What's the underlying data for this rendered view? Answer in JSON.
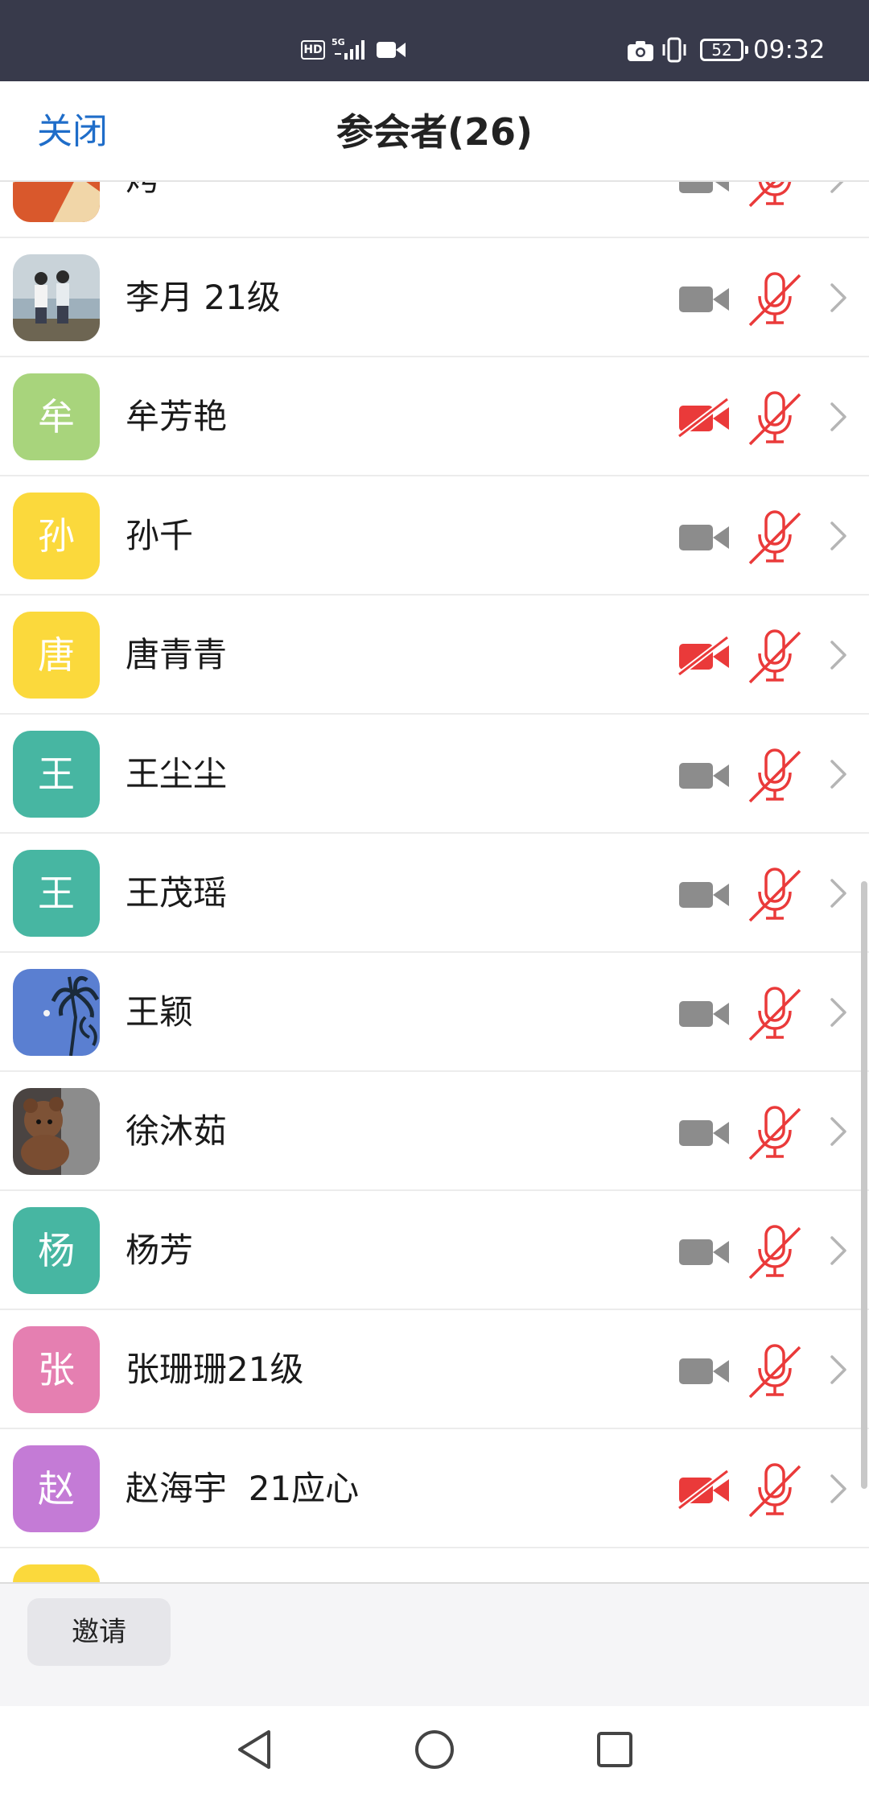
{
  "status_bar": {
    "hd_label": "HD",
    "network_label": "5G",
    "battery": "52",
    "time": "09:32"
  },
  "header": {
    "close_label": "关闭",
    "title": "参会者(26)"
  },
  "participants": [
    {
      "name": "烤-",
      "avatar_type": "photo",
      "avatar_text": "",
      "video_off": false
    },
    {
      "name": "李月 21级",
      "avatar_type": "photo",
      "avatar_text": "",
      "video_off": false
    },
    {
      "name": "牟芳艳",
      "avatar_type": "letter",
      "avatar_text": "牟",
      "avatar_color": "#a8d47c",
      "video_off": true
    },
    {
      "name": "孙千",
      "avatar_type": "letter",
      "avatar_text": "孙",
      "avatar_color": "#fbd93c",
      "video_off": false
    },
    {
      "name": "唐青青",
      "avatar_type": "letter",
      "avatar_text": "唐",
      "avatar_color": "#fbd93c",
      "video_off": true
    },
    {
      "name": "王尘尘",
      "avatar_type": "letter",
      "avatar_text": "王",
      "avatar_color": "#47b6a2",
      "video_off": false
    },
    {
      "name": "王茂瑶",
      "avatar_type": "letter",
      "avatar_text": "王",
      "avatar_color": "#47b6a2",
      "video_off": false
    },
    {
      "name": "王颖",
      "avatar_type": "photo",
      "avatar_text": "",
      "video_off": false
    },
    {
      "name": "徐沐茹",
      "avatar_type": "photo",
      "avatar_text": "",
      "video_off": false
    },
    {
      "name": "杨芳",
      "avatar_type": "letter",
      "avatar_text": "杨",
      "avatar_color": "#47b6a2",
      "video_off": false
    },
    {
      "name": "张珊珊21级",
      "avatar_type": "letter",
      "avatar_text": "张",
      "avatar_color": "#e57fb1",
      "video_off": false
    },
    {
      "name": "赵海宇  21应心",
      "avatar_type": "letter",
      "avatar_text": "赵",
      "avatar_color": "#c47bd6",
      "video_off": true
    },
    {
      "name": "",
      "avatar_type": "letter",
      "avatar_text": "",
      "avatar_color": "#fbd93c",
      "video_off": false
    }
  ],
  "colors": {
    "accent": "#1f6dc9",
    "muted_red": "#ea3a3a",
    "cam_gray": "#8c8c8c"
  },
  "footer": {
    "invite_label": "邀请"
  },
  "nav": {
    "back_icon": "triangle-back-icon",
    "home_icon": "circle-home-icon",
    "recent_icon": "square-recent-icon"
  }
}
